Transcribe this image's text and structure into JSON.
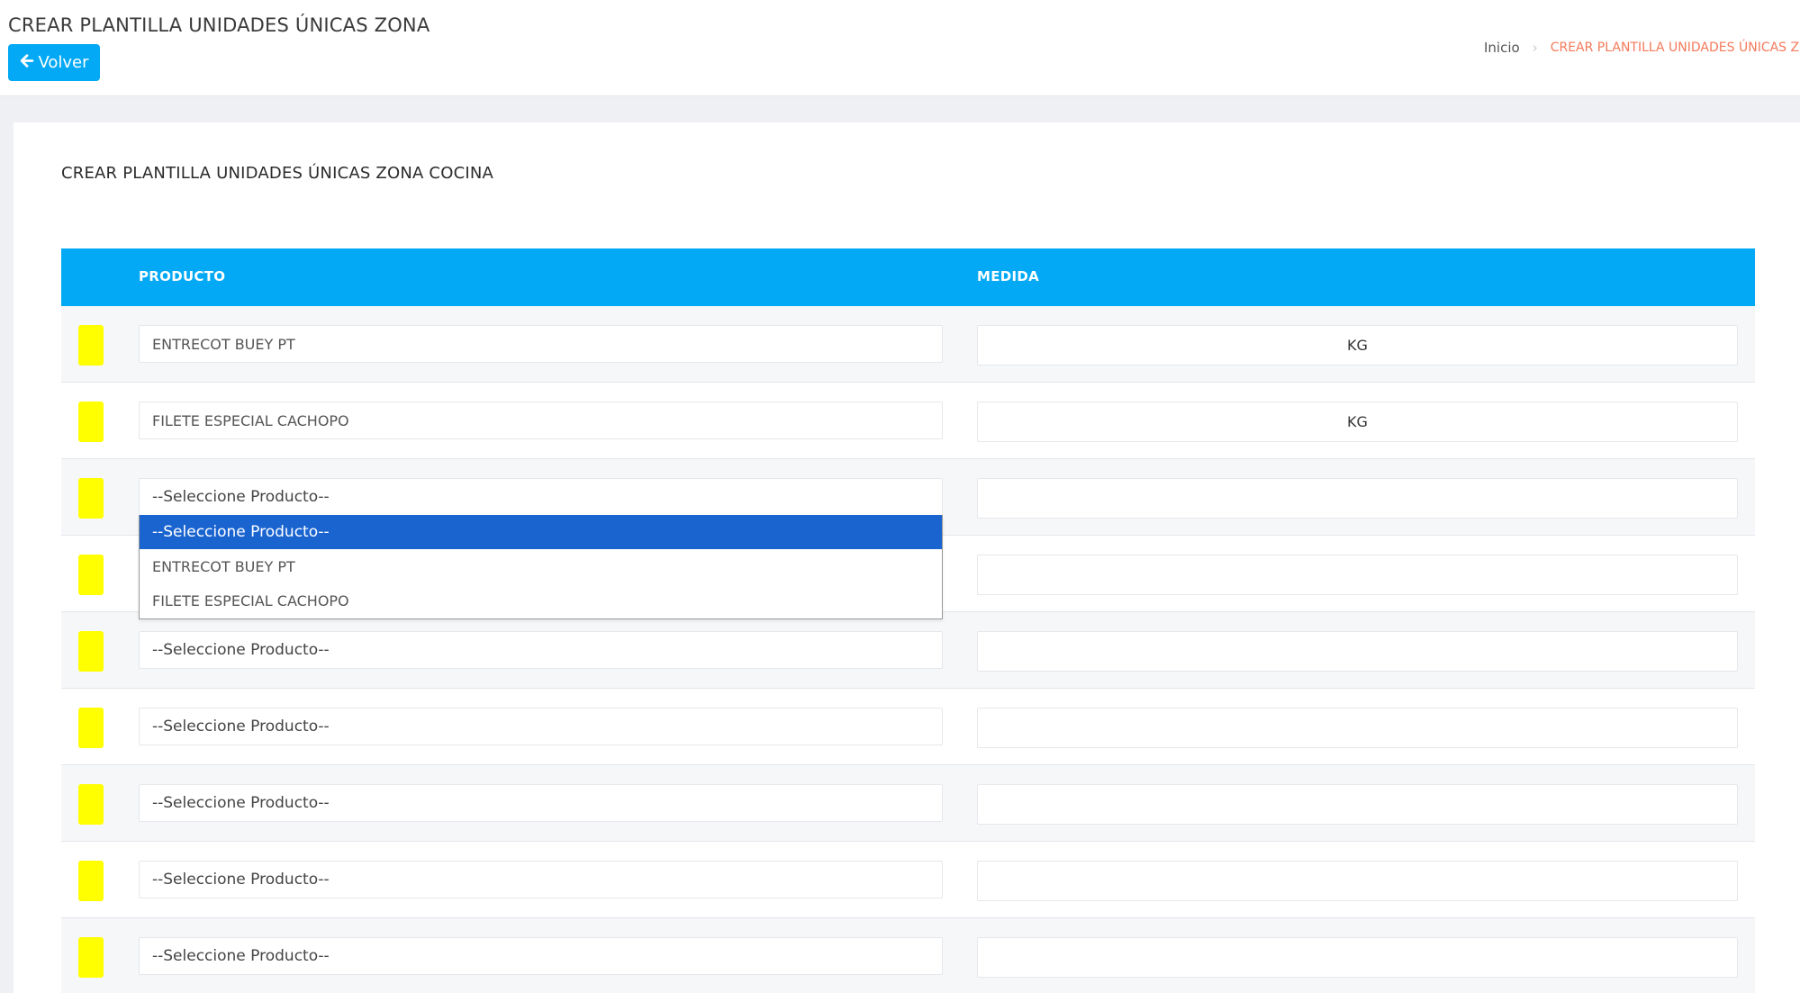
{
  "header": {
    "title": "CREAR PLANTILLA UNIDADES ÚNICAS ZONA",
    "back_label": "Volver",
    "breadcrumb": {
      "home": "Inicio",
      "current": "CREAR PLANTILLA UNIDADES ÚNICAS ZON"
    }
  },
  "card": {
    "title": "CREAR PLANTILLA UNIDADES ÚNICAS ZONA COCINA"
  },
  "table": {
    "columns": {
      "producto": "PRODUCTO",
      "medida": "MEDIDA"
    },
    "marker_color": "#ffff00",
    "header_color": "#03a9f4",
    "rows": [
      {
        "producto": "ENTRECOT BUEY PT",
        "medida": "KG"
      },
      {
        "producto": "FILETE ESPECIAL CACHOPO",
        "medida": "KG"
      },
      {
        "producto": "--Seleccione Producto--",
        "medida": ""
      },
      {
        "producto": "",
        "medida": ""
      },
      {
        "producto": "--Seleccione Producto--",
        "medida": ""
      },
      {
        "producto": "--Seleccione Producto--",
        "medida": ""
      },
      {
        "producto": "--Seleccione Producto--",
        "medida": ""
      },
      {
        "producto": "--Seleccione Producto--",
        "medida": ""
      },
      {
        "producto": "--Seleccione Producto--",
        "medida": ""
      }
    ]
  },
  "dropdown": {
    "options": [
      "--Seleccione Producto--",
      "ENTRECOT BUEY PT",
      "FILETE ESPECIAL CACHOPO"
    ],
    "highlight_color": "#1a64d0"
  }
}
